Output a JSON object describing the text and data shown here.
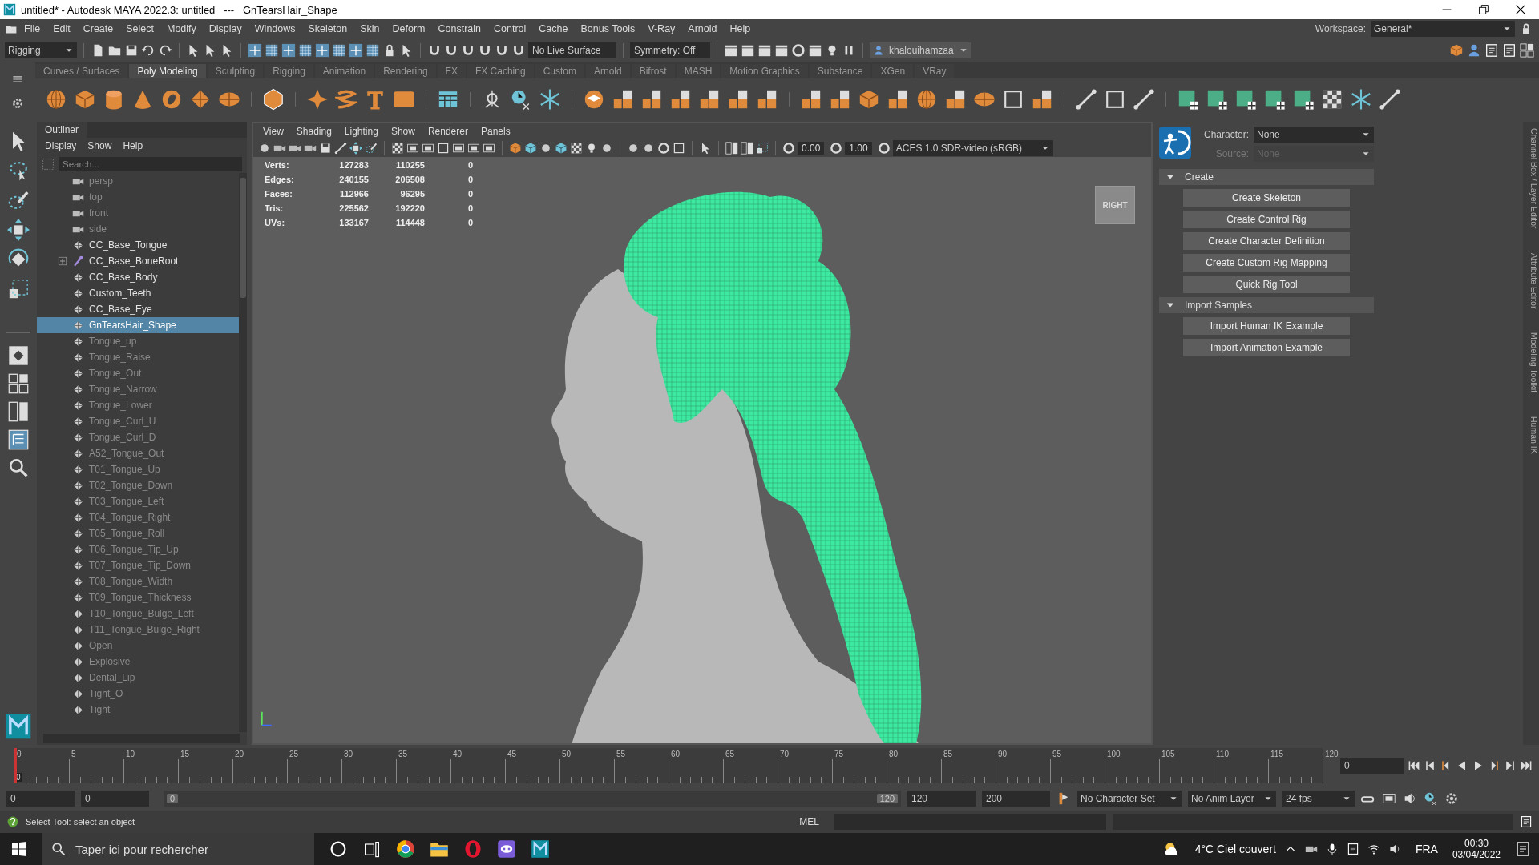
{
  "window": {
    "title": "untitled* - Autodesk MAYA 2022.3: untitled   ---   GnTearsHair_Shape"
  },
  "menu_bar": [
    "File",
    "Edit",
    "Create",
    "Select",
    "Modify",
    "Display",
    "Windows",
    "Skeleton",
    "Skin",
    "Deform",
    "Constrain",
    "Control",
    "Cache",
    "Bonus Tools",
    "V-Ray",
    "Arnold",
    "Help"
  ],
  "status_line": {
    "menu_set": "Rigging",
    "live_surface": "No Live Surface",
    "symmetry": "Symmetry: Off",
    "user": "khalouihamzaa",
    "workspace_label": "Workspace:",
    "workspace": "General*"
  },
  "shelf_tabs": [
    {
      "label": "Curves / Surfaces",
      "selected": false
    },
    {
      "label": "Poly Modeling",
      "selected": true
    },
    {
      "label": "Sculpting",
      "selected": false
    },
    {
      "label": "Rigging",
      "selected": false
    },
    {
      "label": "Animation",
      "selected": false
    },
    {
      "label": "Rendering",
      "selected": false
    },
    {
      "label": "FX",
      "selected": false
    },
    {
      "label": "FX Caching",
      "selected": false
    },
    {
      "label": "Custom",
      "selected": false
    },
    {
      "label": "Arnold",
      "selected": false
    },
    {
      "label": "Bifrost",
      "selected": false
    },
    {
      "label": "MASH",
      "selected": false
    },
    {
      "label": "Motion Graphics",
      "selected": false
    },
    {
      "label": "Substance",
      "selected": false
    },
    {
      "label": "XGen",
      "selected": false
    },
    {
      "label": "VRay",
      "selected": false
    }
  ],
  "outliner": {
    "title": "Outliner",
    "menu": [
      "Display",
      "Show",
      "Help"
    ],
    "search_placeholder": "Search...",
    "items": [
      {
        "label": "persp",
        "kind": "camera",
        "hidden": true,
        "selected": false
      },
      {
        "label": "top",
        "kind": "camera",
        "hidden": true,
        "selected": false
      },
      {
        "label": "front",
        "kind": "camera",
        "hidden": true,
        "selected": false
      },
      {
        "label": "side",
        "kind": "camera",
        "hidden": true,
        "selected": false
      },
      {
        "label": "CC_Base_Tongue",
        "kind": "mesh",
        "hidden": false,
        "selected": false
      },
      {
        "label": "CC_Base_BoneRoot",
        "kind": "joint",
        "hidden": false,
        "selected": false
      },
      {
        "label": "CC_Base_Body",
        "kind": "mesh",
        "hidden": false,
        "selected": false
      },
      {
        "label": "Custom_Teeth",
        "kind": "mesh",
        "hidden": false,
        "selected": false
      },
      {
        "label": "CC_Base_Eye",
        "kind": "mesh",
        "hidden": false,
        "selected": false
      },
      {
        "label": "GnTearsHair_Shape",
        "kind": "mesh",
        "hidden": false,
        "selected": true
      },
      {
        "label": "Tongue_up",
        "kind": "mesh",
        "hidden": true,
        "selected": false
      },
      {
        "label": "Tongue_Raise",
        "kind": "mesh",
        "hidden": true,
        "selected": false
      },
      {
        "label": "Tongue_Out",
        "kind": "mesh",
        "hidden": true,
        "selected": false
      },
      {
        "label": "Tongue_Narrow",
        "kind": "mesh",
        "hidden": true,
        "selected": false
      },
      {
        "label": "Tongue_Lower",
        "kind": "mesh",
        "hidden": true,
        "selected": false
      },
      {
        "label": "Tongue_Curl_U",
        "kind": "mesh",
        "hidden": true,
        "selected": false
      },
      {
        "label": "Tongue_Curl_D",
        "kind": "mesh",
        "hidden": true,
        "selected": false
      },
      {
        "label": "A52_Tongue_Out",
        "kind": "mesh",
        "hidden": true,
        "selected": false
      },
      {
        "label": "T01_Tongue_Up",
        "kind": "mesh",
        "hidden": true,
        "selected": false
      },
      {
        "label": "T02_Tongue_Down",
        "kind": "mesh",
        "hidden": true,
        "selected": false
      },
      {
        "label": "T03_Tongue_Left",
        "kind": "mesh",
        "hidden": true,
        "selected": false
      },
      {
        "label": "T04_Tongue_Right",
        "kind": "mesh",
        "hidden": true,
        "selected": false
      },
      {
        "label": "T05_Tongue_Roll",
        "kind": "mesh",
        "hidden": true,
        "selected": false
      },
      {
        "label": "T06_Tongue_Tip_Up",
        "kind": "mesh",
        "hidden": true,
        "selected": false
      },
      {
        "label": "T07_Tongue_Tip_Down",
        "kind": "mesh",
        "hidden": true,
        "selected": false
      },
      {
        "label": "T08_Tongue_Width",
        "kind": "mesh",
        "hidden": true,
        "selected": false
      },
      {
        "label": "T09_Tongue_Thickness",
        "kind": "mesh",
        "hidden": true,
        "selected": false
      },
      {
        "label": "T10_Tongue_Bulge_Left",
        "kind": "mesh",
        "hidden": true,
        "selected": false
      },
      {
        "label": "T11_Tongue_Bulge_Right",
        "kind": "mesh",
        "hidden": true,
        "selected": false
      },
      {
        "label": "Open",
        "kind": "mesh",
        "hidden": true,
        "selected": false
      },
      {
        "label": "Explosive",
        "kind": "mesh",
        "hidden": true,
        "selected": false
      },
      {
        "label": "Dental_Lip",
        "kind": "mesh",
        "hidden": true,
        "selected": false
      },
      {
        "label": "Tight_O",
        "kind": "mesh",
        "hidden": true,
        "selected": false
      },
      {
        "label": "Tight",
        "kind": "mesh",
        "hidden": true,
        "selected": false
      }
    ]
  },
  "viewport": {
    "menu": [
      "View",
      "Shading",
      "Lighting",
      "Show",
      "Renderer",
      "Panels"
    ],
    "exposure": "0.00",
    "gamma": "1.00",
    "color_space": "ACES 1.0 SDR-video (sRGB)",
    "hud": [
      {
        "label": "Verts:",
        "values": [
          "127283",
          "110255",
          "0"
        ]
      },
      {
        "label": "Edges:",
        "values": [
          "240155",
          "206508",
          "0"
        ]
      },
      {
        "label": "Faces:",
        "values": [
          "112966",
          "96295",
          "0"
        ]
      },
      {
        "label": "Tris:",
        "values": [
          "225562",
          "192220",
          "0"
        ]
      },
      {
        "label": "UVs:",
        "values": [
          "133167",
          "114448",
          "0"
        ]
      }
    ],
    "view_cube": "RIGHT"
  },
  "human_ik": {
    "character_label": "Character:",
    "character": "None",
    "source_label": "Source:",
    "source": "None",
    "source_disabled": true,
    "sections": [
      {
        "title": "Create",
        "expanded": true,
        "buttons": [
          "Create Skeleton",
          "Create Control Rig",
          "Create Character Definition",
          "Create Custom Rig Mapping",
          "Quick Rig Tool"
        ]
      },
      {
        "title": "Import Samples",
        "expanded": true,
        "buttons": [
          "Import Human IK Example",
          "Import Animation Example"
        ]
      }
    ]
  },
  "side_tabs": [
    "Channel Box / Layer Editor",
    "Attribute Editor",
    "Modeling Toolkit",
    "Human IK"
  ],
  "timeline": {
    "ticks": [
      "0",
      "5",
      "10",
      "15",
      "20",
      "25",
      "30",
      "35",
      "40",
      "45",
      "50",
      "55",
      "60",
      "65",
      "70",
      "75",
      "80",
      "85",
      "90",
      "95",
      "100",
      "105",
      "110",
      "115",
      "120"
    ],
    "current_marker": "0",
    "current_frame": "0",
    "level": 0
  },
  "range": {
    "start": "0",
    "playback_start": "0",
    "slider_start": "0",
    "slider_end": "120",
    "level": 1,
    "playback_end": "120",
    "end": "200",
    "character_set": "No Character Set",
    "anim_layer": "No Anim Layer",
    "fps": "24 fps"
  },
  "command_line": {
    "help": "Select Tool: select an object",
    "language": "MEL"
  },
  "taskbar": {
    "search_placeholder": "Taper ici pour rechercher",
    "weather": "4°C Ciel couvert",
    "language": "FRA",
    "time": "00:30",
    "date": "03/04/2022"
  }
}
